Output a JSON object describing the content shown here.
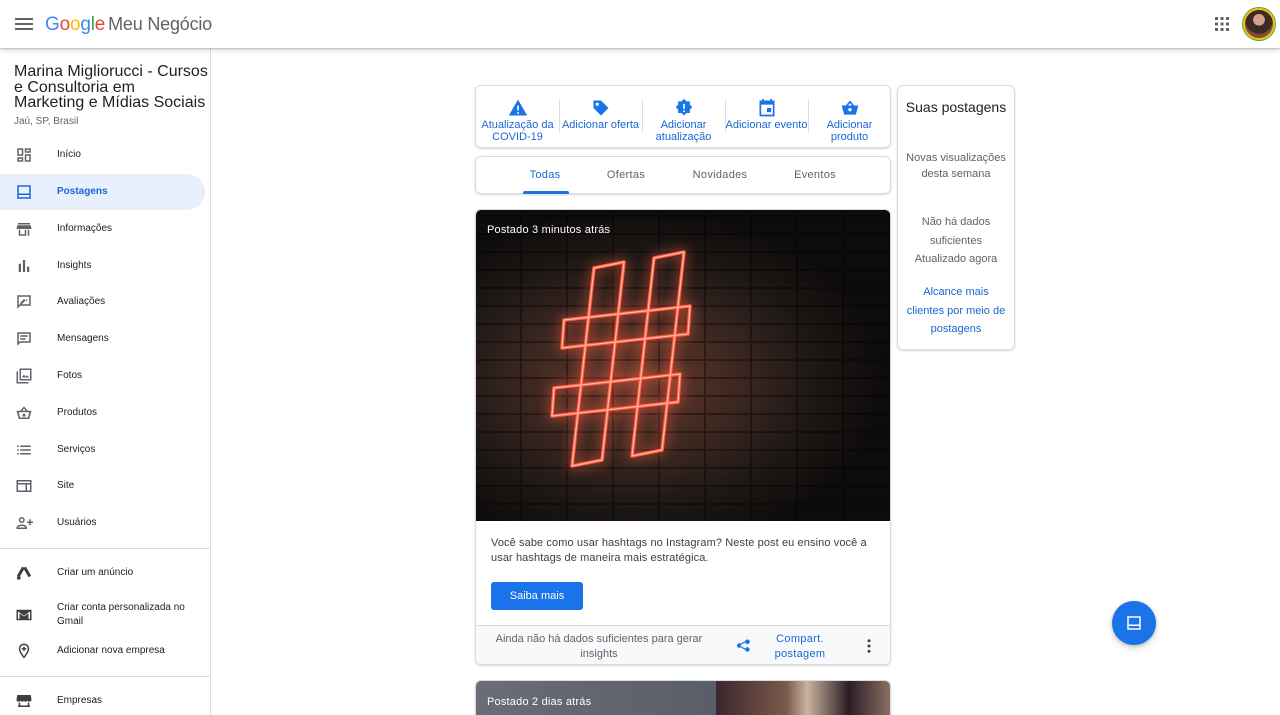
{
  "header": {
    "logo_letters": [
      "G",
      "o",
      "o",
      "g",
      "l",
      "e"
    ],
    "product": "Meu Negócio"
  },
  "business": {
    "name": "Marina Migliorucci - Cursos e Consultoria em Marketing e Mídias Sociais",
    "location": "Jaú, SP, Brasil"
  },
  "sidebar": {
    "items": [
      {
        "label": "Início",
        "icon": "dashboard-icon"
      },
      {
        "label": "Postagens",
        "icon": "posts-icon",
        "active": true
      },
      {
        "label": "Informações",
        "icon": "store-icon"
      },
      {
        "label": "Insights",
        "icon": "bar-chart-icon"
      },
      {
        "label": "Avaliações",
        "icon": "reviews-icon"
      },
      {
        "label": "Mensagens",
        "icon": "message-icon"
      },
      {
        "label": "Fotos",
        "icon": "photos-icon"
      },
      {
        "label": "Produtos",
        "icon": "basket-icon"
      },
      {
        "label": "Serviços",
        "icon": "list-icon"
      },
      {
        "label": "Site",
        "icon": "web-icon"
      },
      {
        "label": "Usuários",
        "icon": "add-user-icon"
      }
    ],
    "extra": [
      {
        "label": "Criar um anúncio",
        "icon": "google-ads-icon"
      },
      {
        "label": "Criar conta personalizada no Gmail",
        "icon": "gmail-icon"
      },
      {
        "label": "Adicionar nova empresa",
        "icon": "add-location-icon"
      }
    ],
    "bottom": [
      {
        "label": "Empresas",
        "icon": "storefront-icon"
      }
    ]
  },
  "actions": [
    {
      "label": "Atualização da COVID-19",
      "icon": "warning-icon"
    },
    {
      "label": "Adicionar oferta",
      "icon": "tag-icon"
    },
    {
      "label": "Adicionar atualização",
      "icon": "update-icon"
    },
    {
      "label": "Adicionar evento",
      "icon": "calendar-icon"
    },
    {
      "label": "Adicionar produto",
      "icon": "basket-icon"
    }
  ],
  "tabs": [
    "Todas",
    "Ofertas",
    "Novidades",
    "Eventos"
  ],
  "active_tab": "Todas",
  "post": {
    "meta": "Postado 3 minutos atrás",
    "text": "Você sabe como usar hashtags no Instagram? Neste post eu ensino você a usar hashtags de maneira mais estratégica.",
    "button": "Saiba mais",
    "insights": "Ainda não há dados suficientes para gerar insights",
    "share": "Compart. postagem"
  },
  "post2": {
    "meta": "Postado 2 dias atrás"
  },
  "stats": {
    "title": "Suas postagens",
    "subtitle": "Novas visualizações desta semana",
    "nodata": "Não há dados suficientes",
    "updated": "Atualizado agora",
    "link": "Alcance mais clientes por meio de postagens"
  },
  "colors": {
    "accent": "#1a73e8",
    "active_bg": "#e8f0fe",
    "neon": "#ff5a3c"
  }
}
